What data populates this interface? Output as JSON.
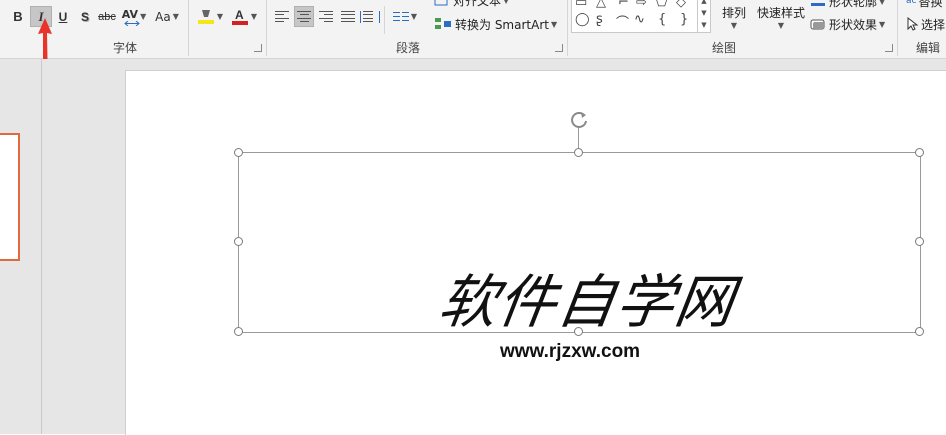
{
  "ribbon": {
    "font_group": {
      "label": "字体",
      "bold": "B",
      "italic": "I",
      "underline": "U",
      "shadow": "S",
      "strikethrough": "abc",
      "char_spacing": "AV",
      "change_case": "Aa",
      "highlight_color": "#f5e51b",
      "font_color": "#d42020",
      "italic_pressed": true
    },
    "paragraph_group": {
      "label": "段落",
      "align_text": "对齐文本",
      "convert_smartart": "转换为 SmartArt"
    },
    "drawing_group": {
      "label": "绘图",
      "arrange": "排列",
      "quick_styles": "快速样式",
      "shape_outline": "形状轮廓",
      "shape_effects": "形状效果"
    },
    "editing_group": {
      "label": "编辑",
      "replace": "替换",
      "select": "选择"
    }
  },
  "slide": {
    "title_text": "软件自学网",
    "url_text": "www.rjzxw.com"
  },
  "annotation": {
    "arrow_color": "#e8332a"
  }
}
